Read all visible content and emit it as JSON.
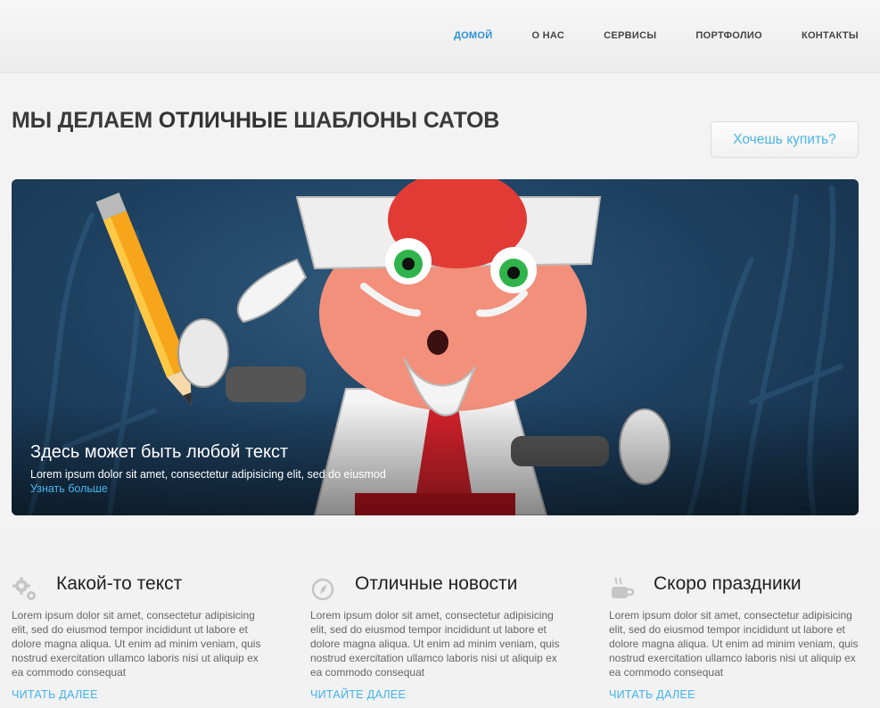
{
  "nav": {
    "items": [
      "ДОМОЙ",
      "О НАС",
      "СЕРВИСЫ",
      "ПОРТФОЛИО",
      "КОНТАКТЫ"
    ],
    "active_index": 0
  },
  "headline": {
    "before": "МЫ ДЕЛАЕМ ",
    "bold": "ОТЛИЧНЫЕ",
    "after": " ШАБЛОНЫ САТОВ"
  },
  "buy_button": "Хочешь купить?",
  "hero": {
    "title": "Здесь может быть любой текст",
    "text": "Lorem ipsum dolor sit amet, consectetur adipisicing elit, sed do eiusmod",
    "link": "Узнать больше"
  },
  "features": [
    {
      "icon": "gears-icon",
      "title": "Какой-то текст",
      "text": "Lorem ipsum dolor sit amet, consectetur adipisicing elit, sed do eiusmod tempor incididunt ut labore et dolore magna aliqua. Ut enim ad minim veniam, quis nostrud exercitation ullamco laboris nisi ut aliquip ex ea commodo consequat",
      "link": "ЧИТАТЬ ДАЛЕЕ"
    },
    {
      "icon": "compass-icon",
      "title": "Отличные новости",
      "text": "Lorem ipsum dolor sit amet, consectetur adipisicing elit, sed do eiusmod tempor incididunt ut labore et dolore magna aliqua. Ut enim ad minim veniam, quis nostrud exercitation ullamco laboris nisi ut aliquip ex ea commodo consequat",
      "link": "ЧИТАЙТЕ ДАЛЕЕ"
    },
    {
      "icon": "coffee-cup-icon",
      "title": "Скоро праздники",
      "text": "Lorem ipsum dolor sit amet, consectetur adipisicing elit, sed do eiusmod tempor incididunt ut labore et dolore magna aliqua. Ut enim ad minim veniam, quis nostrud exercitation ullamco laboris nisi ut aliquip ex ea commodo consequat",
      "link": "ЧИТАТЬ ДАЛЕЕ"
    }
  ],
  "colors": {
    "accent": "#2a8fd6",
    "link": "#3fb2ec",
    "hero_bg": "#1f4262"
  }
}
